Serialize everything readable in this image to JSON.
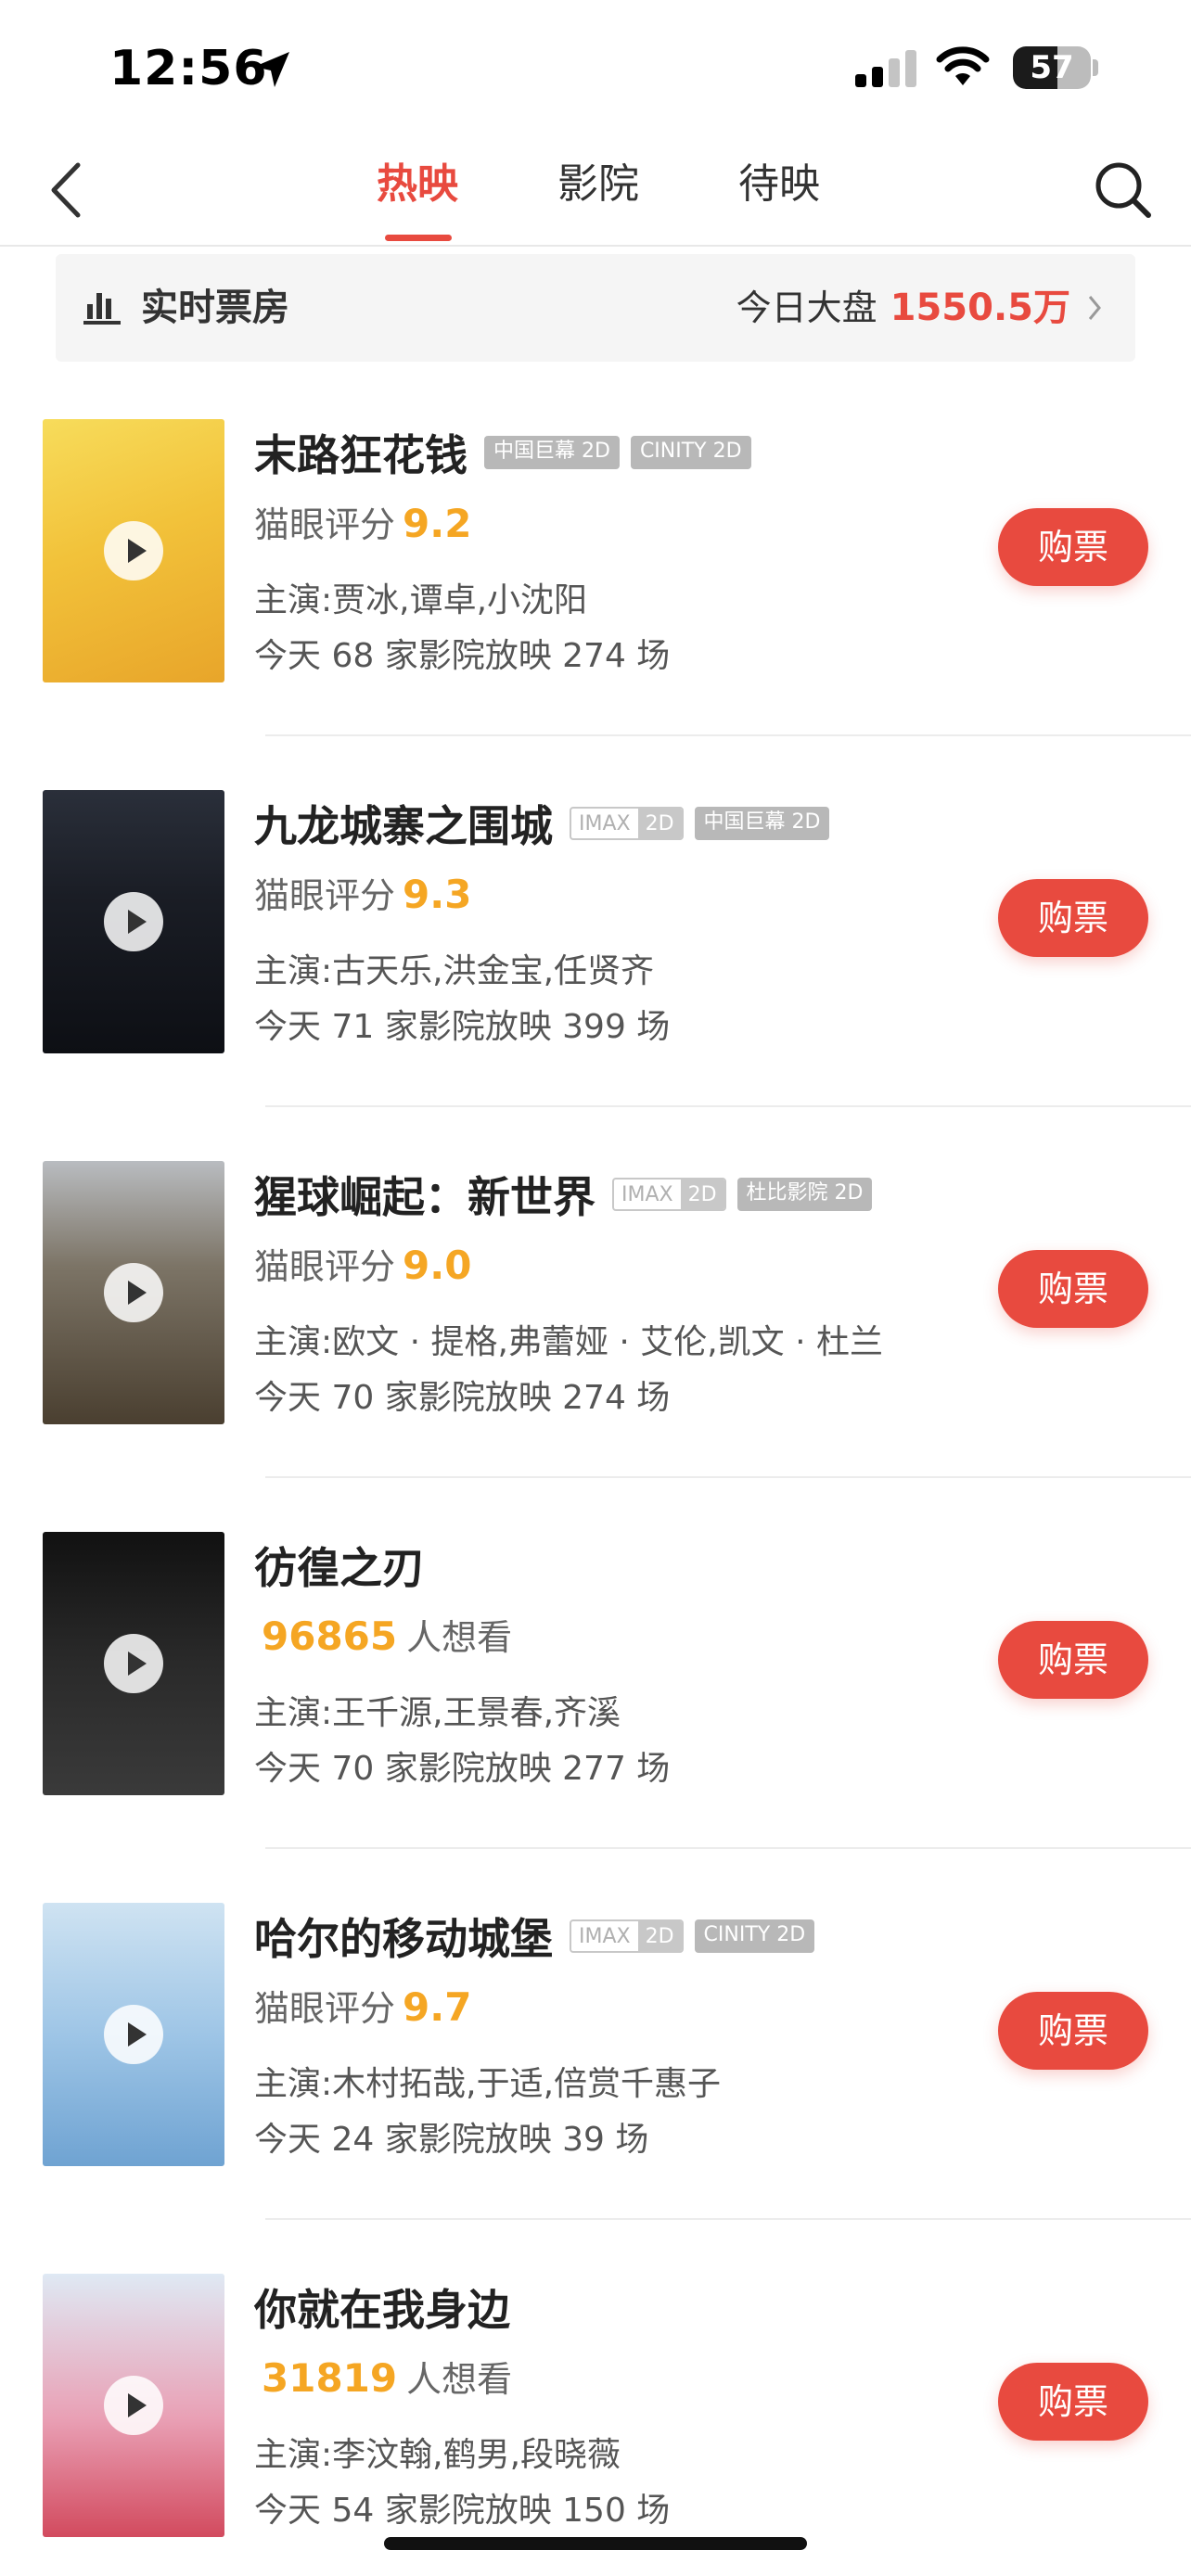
{
  "status_bar": {
    "time": "12:56",
    "battery": "57",
    "battery_level": 0.57
  },
  "nav": {
    "tabs": [
      {
        "label": "热映"
      },
      {
        "label": "影院"
      },
      {
        "label": "待映"
      }
    ],
    "active_tab": "热映"
  },
  "box_office": {
    "label": "实时票房",
    "today_label": "今日大盘",
    "today_amount": "1550.5万"
  },
  "colors": {
    "accent": "#e84a3f",
    "score": "#f5a623"
  },
  "movies": [
    {
      "title": "末路狂花钱",
      "tags": [
        "中国巨幕 2D",
        "CINITY 2D"
      ],
      "score_label": "猫眼评分",
      "score": "9.2",
      "cast": "主演:贾冰,谭卓,小沈阳",
      "showings": "今天 68 家影院放映 274 场",
      "buy": "购票"
    },
    {
      "title": "九龙城寨之围城",
      "imax": {
        "a": "IMAX",
        "b": "2D"
      },
      "tags": [
        "中国巨幕 2D"
      ],
      "score_label": "猫眼评分",
      "score": "9.3",
      "cast": "主演:古天乐,洪金宝,任贤齐",
      "showings": "今天 71 家影院放映 399 场",
      "buy": "购票"
    },
    {
      "title": "猩球崛起：新世界",
      "imax": {
        "a": "IMAX",
        "b": "2D"
      },
      "tags": [
        "杜比影院 2D"
      ],
      "score_label": "猫眼评分",
      "score": "9.0",
      "cast": "主演:欧文 · 提格,弗蕾娅 · 艾伦,凯文 · 杜兰",
      "showings": "今天 70 家影院放映 274 场",
      "buy": "购票"
    },
    {
      "title": "彷徨之刃",
      "want_count": "96865",
      "want_label": "人想看",
      "cast": "主演:王千源,王景春,齐溪",
      "showings": "今天 70 家影院放映 277 场",
      "buy": "购票"
    },
    {
      "title": "哈尔的移动城堡",
      "imax": {
        "a": "IMAX",
        "b": "2D"
      },
      "tags": [
        "CINITY 2D"
      ],
      "score_label": "猫眼评分",
      "score": "9.7",
      "cast": "主演:木村拓哉,于适,倍赏千惠子",
      "showings": "今天 24 家影院放映 39 场",
      "buy": "购票"
    },
    {
      "title": "你就在我身边",
      "want_count": "31819",
      "want_label": "人想看",
      "cast": "主演:李汶翰,鹤男,段晓薇",
      "showings": "今天 54 家影院放映 150 场",
      "buy": "购票"
    }
  ]
}
